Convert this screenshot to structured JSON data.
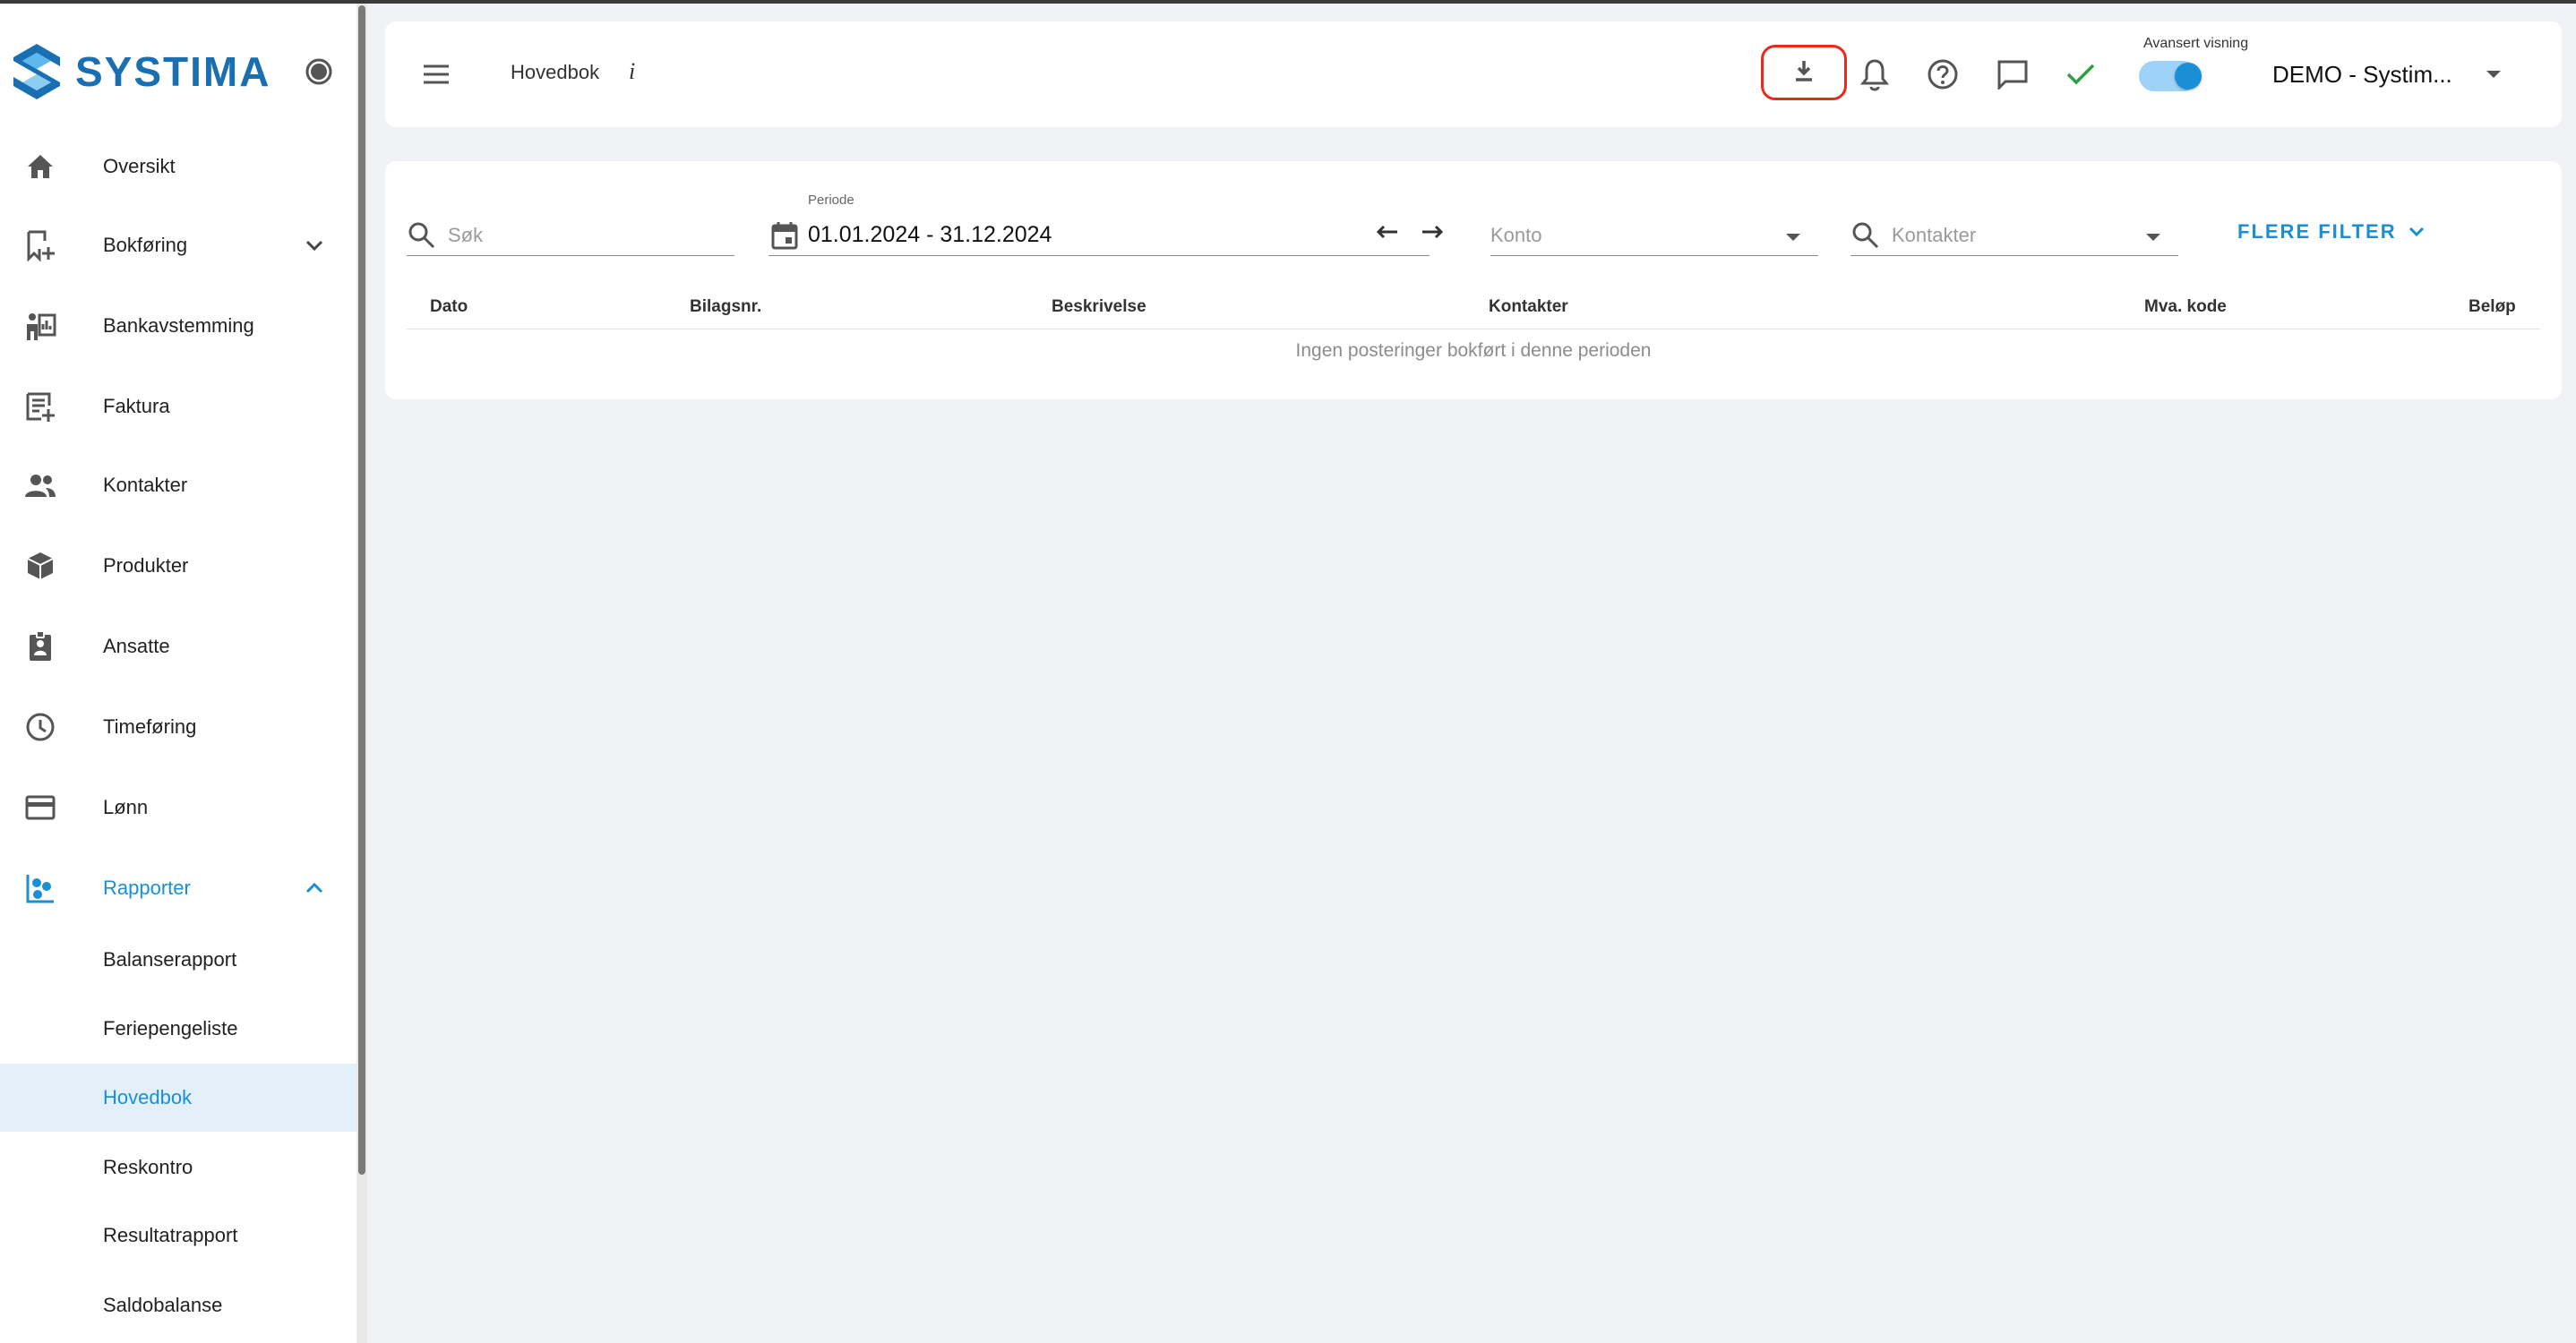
{
  "app": {
    "logo_text": "SYSTIMA"
  },
  "sidebar": {
    "items": [
      {
        "label": "Oversikt",
        "icon": "home-icon"
      },
      {
        "label": "Bokføring",
        "icon": "bookmark-add-icon"
      },
      {
        "label": "Bankavstemming",
        "icon": "bank-reconcile-icon"
      },
      {
        "label": "Faktura",
        "icon": "invoice-icon"
      },
      {
        "label": "Kontakter",
        "icon": "people-icon"
      },
      {
        "label": "Produkter",
        "icon": "cube-icon"
      },
      {
        "label": "Ansatte",
        "icon": "badge-icon"
      },
      {
        "label": "Timeføring",
        "icon": "clock-icon"
      },
      {
        "label": "Lønn",
        "icon": "card-icon"
      },
      {
        "label": "Rapporter",
        "icon": "report-icon"
      }
    ],
    "sub_items": [
      {
        "label": "Balanserapport"
      },
      {
        "label": "Feriepengeliste"
      },
      {
        "label": "Hovedbok"
      },
      {
        "label": "Reskontro"
      },
      {
        "label": "Resultatrapport"
      },
      {
        "label": "Saldobalanse"
      }
    ],
    "active_item": "Rapporter",
    "selected_sub_item": "Hovedbok"
  },
  "header": {
    "title": "Hovedbok",
    "info_label": "i",
    "advanced_view_label": "Avansert visning",
    "advanced_view_on": true,
    "company": "DEMO - Systim...",
    "icons": [
      "download-icon",
      "bell-icon",
      "help-icon",
      "chat-icon",
      "check-icon"
    ]
  },
  "filters": {
    "search_placeholder": "Søk",
    "period_label": "Periode",
    "period_value": "01.01.2024 - 31.12.2024",
    "account_placeholder": "Konto",
    "contacts_placeholder": "Kontakter",
    "more_filters_label": "FLERE FILTER"
  },
  "table": {
    "columns": [
      "Dato",
      "Bilagsnr.",
      "Beskrivelse",
      "Kontakter",
      "Mva. kode",
      "Beløp"
    ],
    "rows": [],
    "empty_message": "Ingen posteringer bokført i denne perioden"
  },
  "colors": {
    "accent": "#1a8fd6",
    "brand": "#1a6fb3",
    "highlight_border": "#e8291c",
    "check": "#2e9e44",
    "background": "#f1f2f6"
  }
}
